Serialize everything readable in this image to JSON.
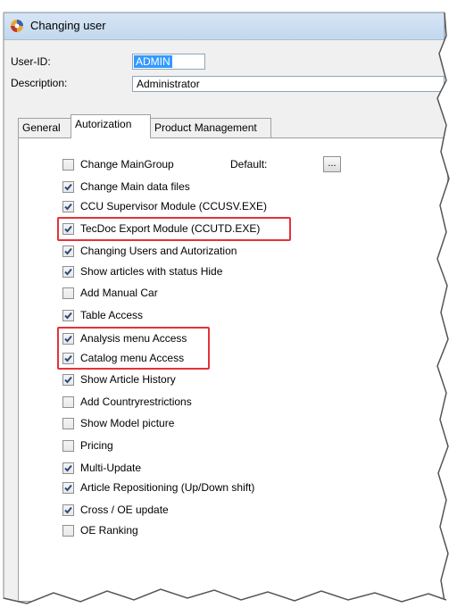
{
  "window": {
    "title": "Changing user"
  },
  "form": {
    "user_id_label": "User-ID:",
    "user_id_value": "ADMIN",
    "description_label": "Description:",
    "description_value": "Administrator"
  },
  "tabs": [
    {
      "label": "General"
    },
    {
      "label": "Autorization"
    },
    {
      "label": "Product Management"
    }
  ],
  "default": {
    "label": "Default:",
    "button_label": "..."
  },
  "permissions": [
    {
      "label": "Change MainGroup",
      "checked": false
    },
    {
      "label": "Change  Main data files",
      "checked": true
    },
    {
      "label": "CCU Supervisor Module  (CCUSV.EXE)",
      "checked": true
    },
    {
      "label": "TecDoc Export Module  (CCUTD.EXE)",
      "checked": true
    },
    {
      "label": "Changing Users and Autorization",
      "checked": true
    },
    {
      "label": "Show articles with status Hide",
      "checked": true
    },
    {
      "label": "Add Manual Car",
      "checked": false
    },
    {
      "label": "Table Access",
      "checked": true
    },
    {
      "label": "Analysis menu Access",
      "checked": true
    },
    {
      "label": "Catalog menu Access",
      "checked": true
    },
    {
      "label": "Show Article History",
      "checked": true
    },
    {
      "label": "Add Countryrestrictions",
      "checked": false
    },
    {
      "label": "Show Model picture",
      "checked": false
    },
    {
      "label": "Pricing",
      "checked": false
    },
    {
      "label": "Multi-Update",
      "checked": true
    },
    {
      "label": "Article Repositioning (Up/Down shift)",
      "checked": true
    },
    {
      "label": "Cross / OE update",
      "checked": true
    },
    {
      "label": "OE Ranking",
      "checked": false
    }
  ],
  "colors": {
    "highlight": "#e53238",
    "selection": "#3399ff",
    "titlebar": "#c3d8ee"
  }
}
